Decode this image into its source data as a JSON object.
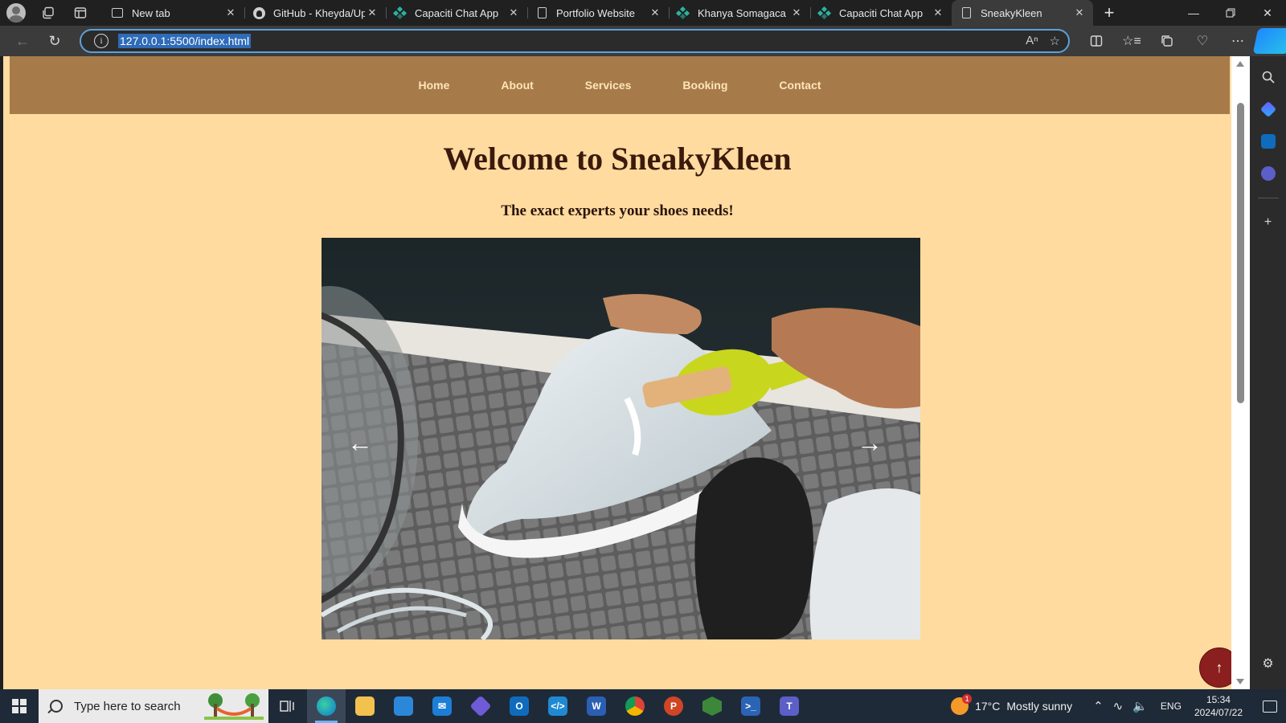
{
  "browser": {
    "tabs": [
      {
        "title": "New tab",
        "icon": "new-tab-icon",
        "active": false
      },
      {
        "title": "GitHub - Kheyda/Upd",
        "icon": "github-icon",
        "active": false
      },
      {
        "title": "Capaciti Chat App",
        "icon": "capaciti-icon",
        "active": false
      },
      {
        "title": "Portfolio Website",
        "icon": "document-icon",
        "active": false
      },
      {
        "title": "Khanya Somagaca Po",
        "icon": "capaciti-icon",
        "active": false
      },
      {
        "title": "Capaciti Chat App",
        "icon": "capaciti-icon",
        "active": false
      },
      {
        "title": "SneakyKleen",
        "icon": "document-icon",
        "active": true
      }
    ],
    "url": "127.0.0.1:5500/index.html"
  },
  "site": {
    "nav": [
      "Home",
      "About",
      "Services",
      "Booking",
      "Contact"
    ],
    "hero_title": "Welcome to SneakyKleen",
    "hero_subtitle": "The exact experts your shoes needs!",
    "carousel_prev": "←",
    "carousel_next": "→",
    "back_to_top": "↑",
    "colors": {
      "page_bg": "#ffdba0",
      "nav_bg": "#a67b49",
      "nav_text": "#ffe5b8",
      "title": "#3a1a0c",
      "back_to_top": "#8b1e1e"
    }
  },
  "taskbar": {
    "search_placeholder": "Type here to search",
    "weather_temp": "17°C",
    "weather_text": "Mostly sunny",
    "language": "ENG",
    "time": "15:34",
    "date": "2024/07/22"
  }
}
